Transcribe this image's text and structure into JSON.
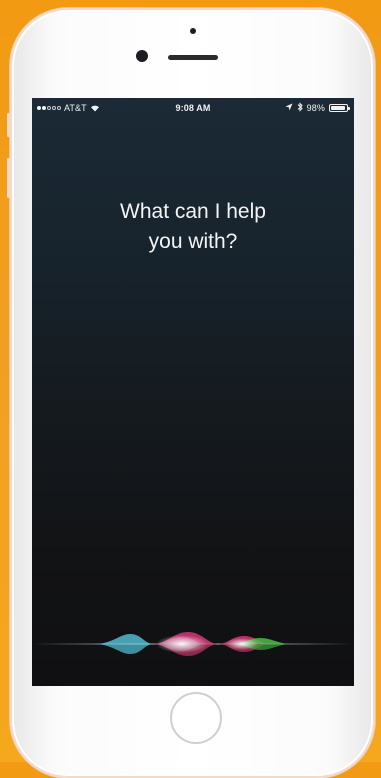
{
  "device": {
    "model": "iPhone",
    "body_color": "#ffffff",
    "background_color": "#f29a12"
  },
  "status_bar": {
    "carrier": "AT&T",
    "signal_bars_filled": 2,
    "signal_bars_total": 5,
    "wifi_icon": "wifi-icon",
    "time": "9:08 AM",
    "location_icon": "location-arrow-icon",
    "bluetooth_icon": "bluetooth-icon",
    "battery": "98%",
    "battery_level": 0.98
  },
  "siri": {
    "prompt_line1": "What can I help",
    "prompt_line2": "you with?",
    "waveform_colors": [
      "#5ad2e8",
      "#e0397e",
      "#ffffff",
      "#4ec94b"
    ]
  },
  "home_button": {
    "icon": "home-button"
  }
}
